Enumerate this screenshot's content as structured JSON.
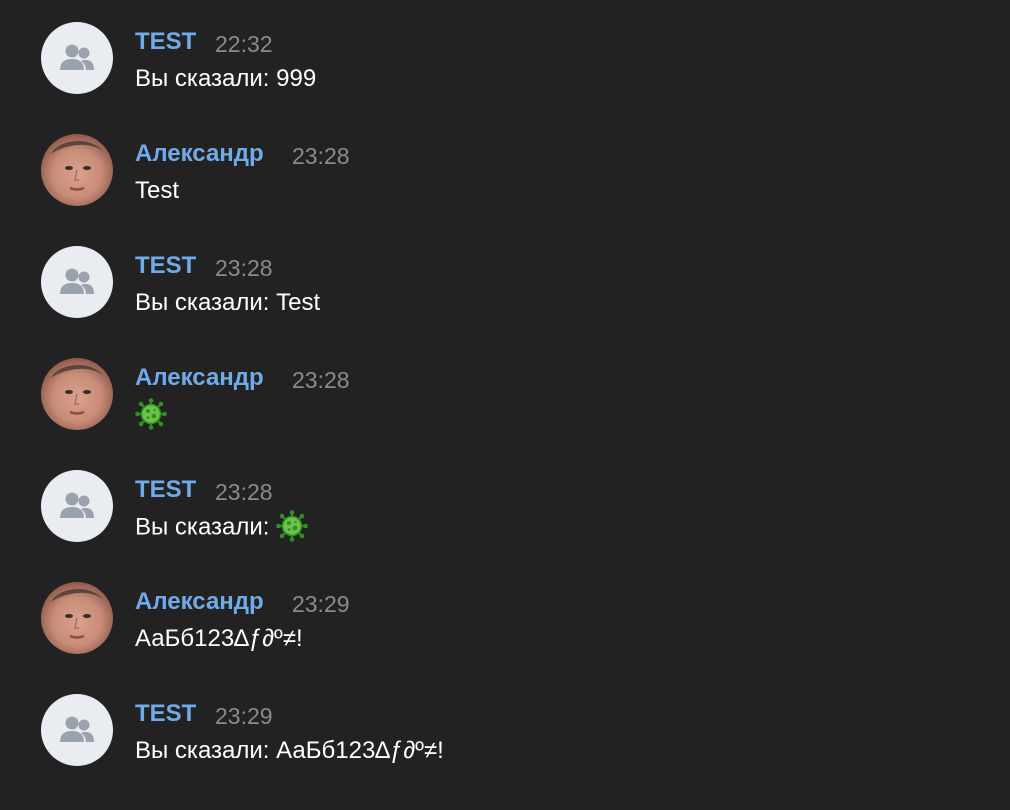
{
  "colors": {
    "background": "#222222",
    "author": "#71aaeb",
    "time": "#8b8b8b",
    "text": "#ffffff"
  },
  "messages": [
    {
      "author": "TEST",
      "avatar": "group-icon",
      "time": "22:32",
      "text": "Вы сказали: 999"
    },
    {
      "author": "Александр",
      "avatar": "user-photo",
      "time": "23:28",
      "text": "Test"
    },
    {
      "author": "TEST",
      "avatar": "group-icon",
      "time": "23:28",
      "text": "Вы сказали: Test"
    },
    {
      "author": "Александр",
      "avatar": "user-photo",
      "time": "23:28",
      "text": "🦠"
    },
    {
      "author": "TEST",
      "avatar": "group-icon",
      "time": "23:28",
      "text_prefix": "Вы сказали: ",
      "text": "🦠"
    },
    {
      "author": "Александр",
      "avatar": "user-photo",
      "time": "23:29",
      "text": "АаБб123∆ƒ∂º≠!"
    },
    {
      "author": "TEST",
      "avatar": "group-icon",
      "time": "23:29",
      "text": "Вы сказали: АаБб123∆ƒ∂º≠!"
    }
  ]
}
